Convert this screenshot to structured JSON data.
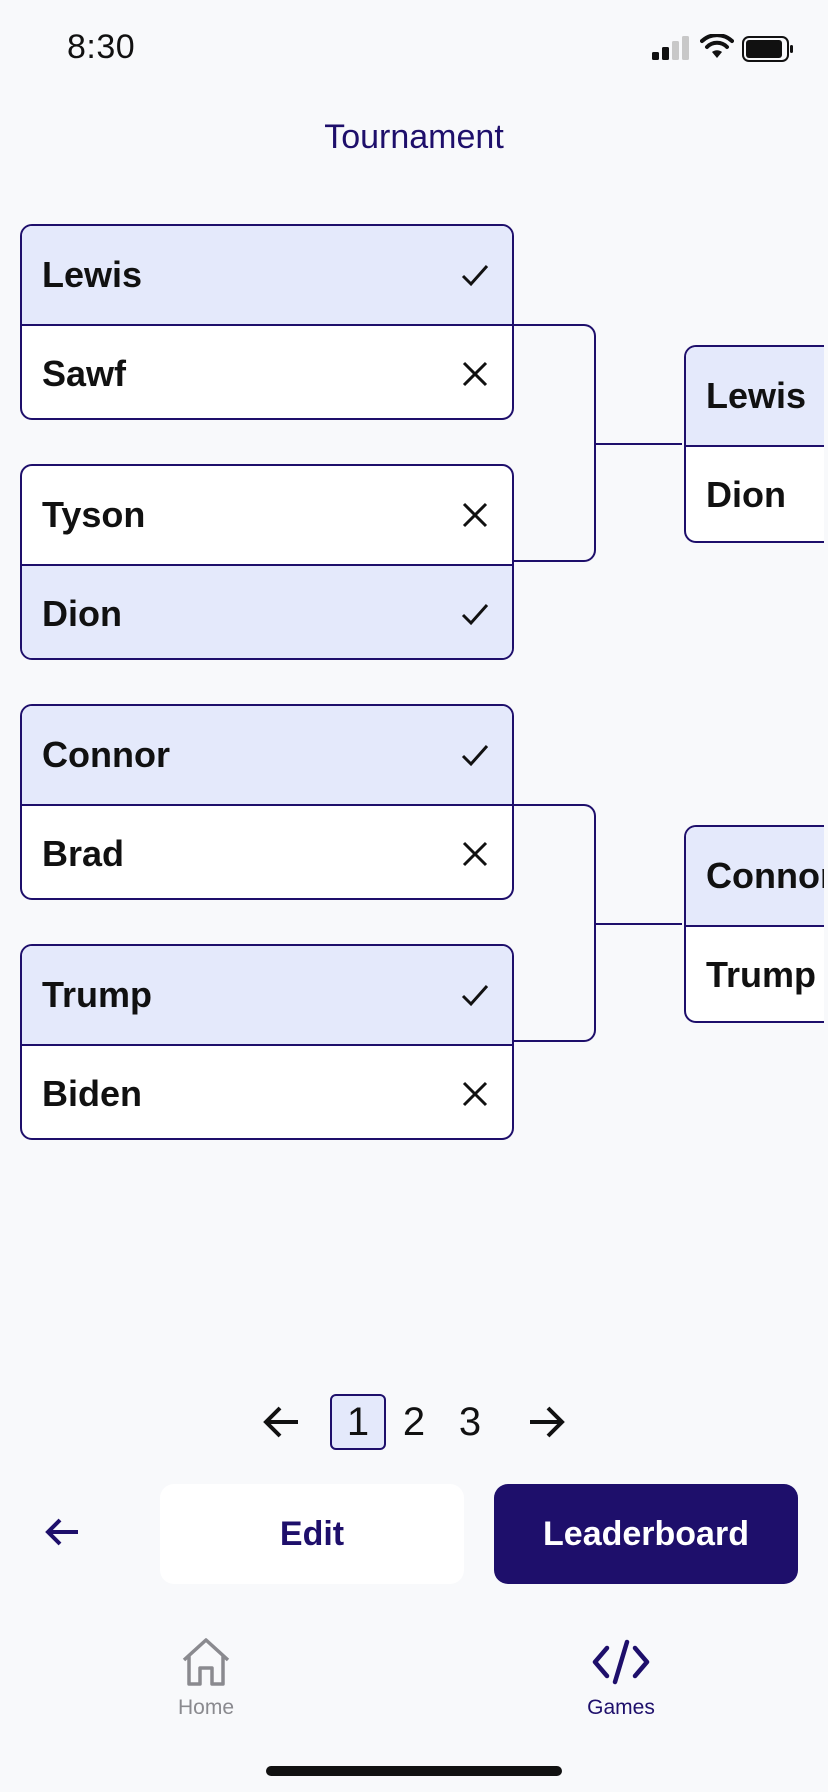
{
  "status_bar": {
    "time": "8:30"
  },
  "header": {
    "title": "Tournament"
  },
  "bracket": {
    "round1": [
      {
        "top": {
          "name": "Lewis",
          "result": "win"
        },
        "bottom": {
          "name": "Sawf",
          "result": "loss"
        }
      },
      {
        "top": {
          "name": "Tyson",
          "result": "loss"
        },
        "bottom": {
          "name": "Dion",
          "result": "win"
        }
      },
      {
        "top": {
          "name": "Connor",
          "result": "win"
        },
        "bottom": {
          "name": "Brad",
          "result": "loss"
        }
      },
      {
        "top": {
          "name": "Trump",
          "result": "win"
        },
        "bottom": {
          "name": "Biden",
          "result": "loss"
        }
      }
    ],
    "round2": [
      {
        "top": {
          "name": "Lewis"
        },
        "bottom": {
          "name": "Dion"
        }
      },
      {
        "top": {
          "name": "Connor"
        },
        "bottom": {
          "name": "Trump"
        }
      }
    ]
  },
  "pagination": {
    "pages": [
      "1",
      "2",
      "3"
    ],
    "current": "1"
  },
  "actions": {
    "edit_label": "Edit",
    "leaderboard_label": "Leaderboard"
  },
  "tab_bar": {
    "items": [
      {
        "label": "Home",
        "icon": "home-icon",
        "active": false
      },
      {
        "label": "Games",
        "icon": "code-icon",
        "active": true
      }
    ]
  },
  "colors": {
    "accent": "#1e0f6b",
    "winner_bg": "#e4e9fb",
    "background": "#f8f9fb"
  }
}
